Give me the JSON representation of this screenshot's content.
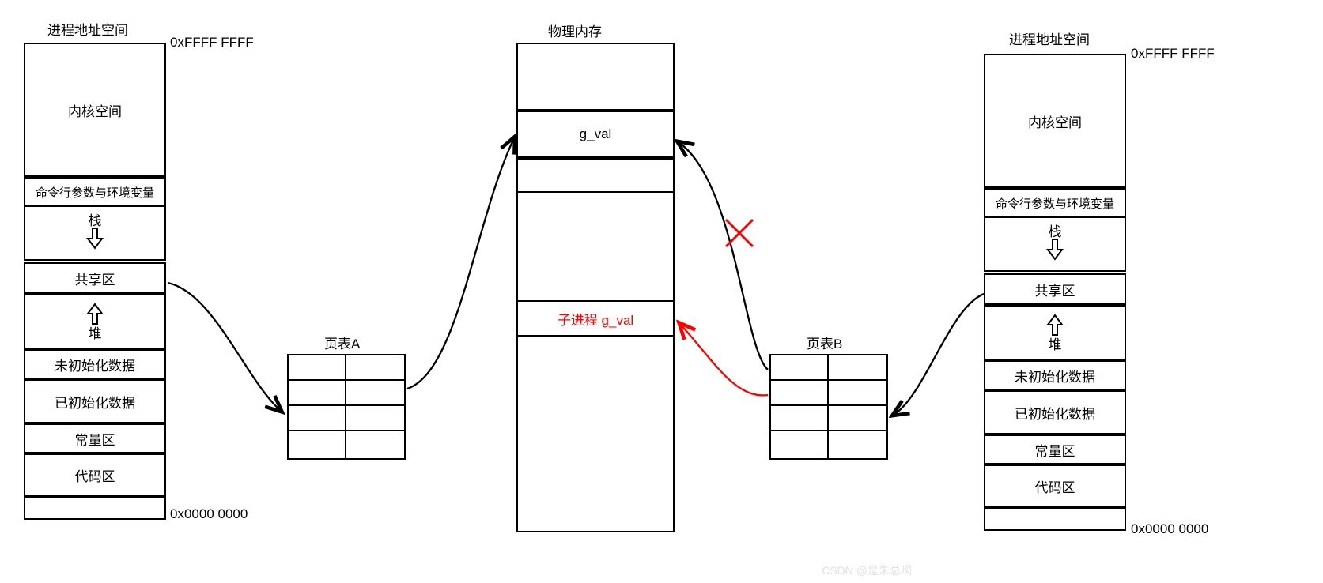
{
  "left": {
    "title": "进程地址空间",
    "high": "0xFFFF FFFF",
    "low": "0x0000 0000",
    "kernel": "内核空间",
    "env": "命令行参数与环境变量",
    "stack": "栈",
    "shared": "共享区",
    "heap": "堆",
    "bss": "未初始化数据",
    "data": "已初始化数据",
    "rodata": "常量区",
    "text": "代码区"
  },
  "right": {
    "title": "进程地址空间",
    "high": "0xFFFF FFFF",
    "low": "0x0000 0000",
    "kernel": "内核空间",
    "env": "命令行参数与环境变量",
    "stack": "栈",
    "shared": "共享区",
    "heap": "堆",
    "bss": "未初始化数据",
    "data": "已初始化数据",
    "rodata": "常量区",
    "text": "代码区"
  },
  "phys": {
    "title": "物理内存",
    "gval": "g_val",
    "child_gval": "子进程 g_val"
  },
  "pta": "页表A",
  "ptb": "页表B",
  "watermark": "CSDN @是朱总啊"
}
